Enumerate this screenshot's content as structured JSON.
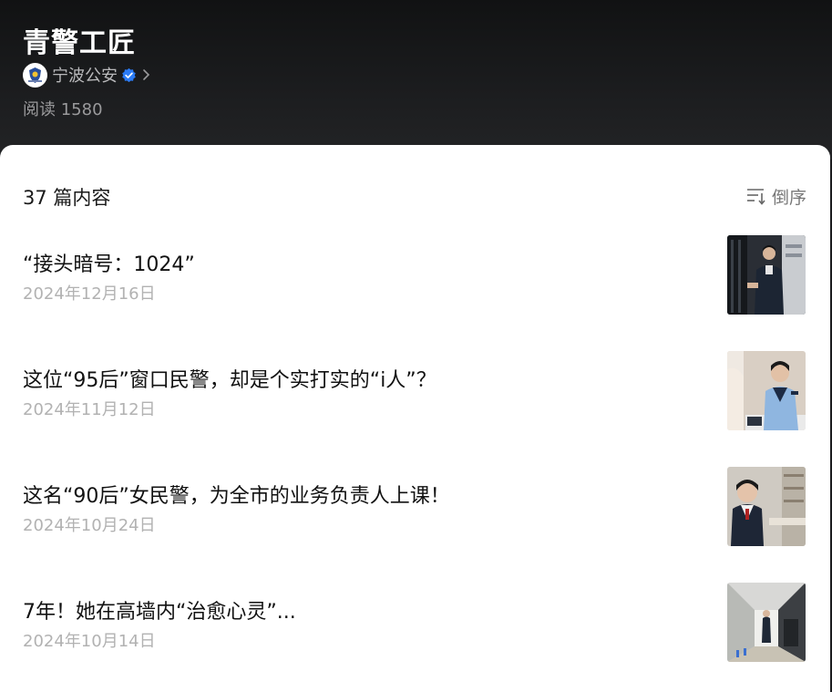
{
  "header": {
    "title": "青警工匠",
    "account_name": "宁波公安",
    "reads": "阅读 1580"
  },
  "list": {
    "count_label": "37 篇内容",
    "sort_label": "倒序",
    "items": [
      {
        "title": "“接头暗号：1024”",
        "date": "2024年12月16日"
      },
      {
        "title": "这位“95后”窗口民警，却是个实打实的“i人”？",
        "date": "2024年11月12日"
      },
      {
        "title": "这名“90后”女民警，为全市的业务负责人上课！",
        "date": "2024年10月24日"
      },
      {
        "title": "7年！她在高墙内“治愈心灵”...",
        "date": "2024年10月14日"
      }
    ]
  },
  "colors": {
    "header_bg": "#1b1c1e",
    "verified_blue": "#2b7bf5",
    "date_gray": "#b2b2b2"
  },
  "icons": [
    "verified-icon",
    "chevron-right-icon",
    "sort-icon"
  ]
}
